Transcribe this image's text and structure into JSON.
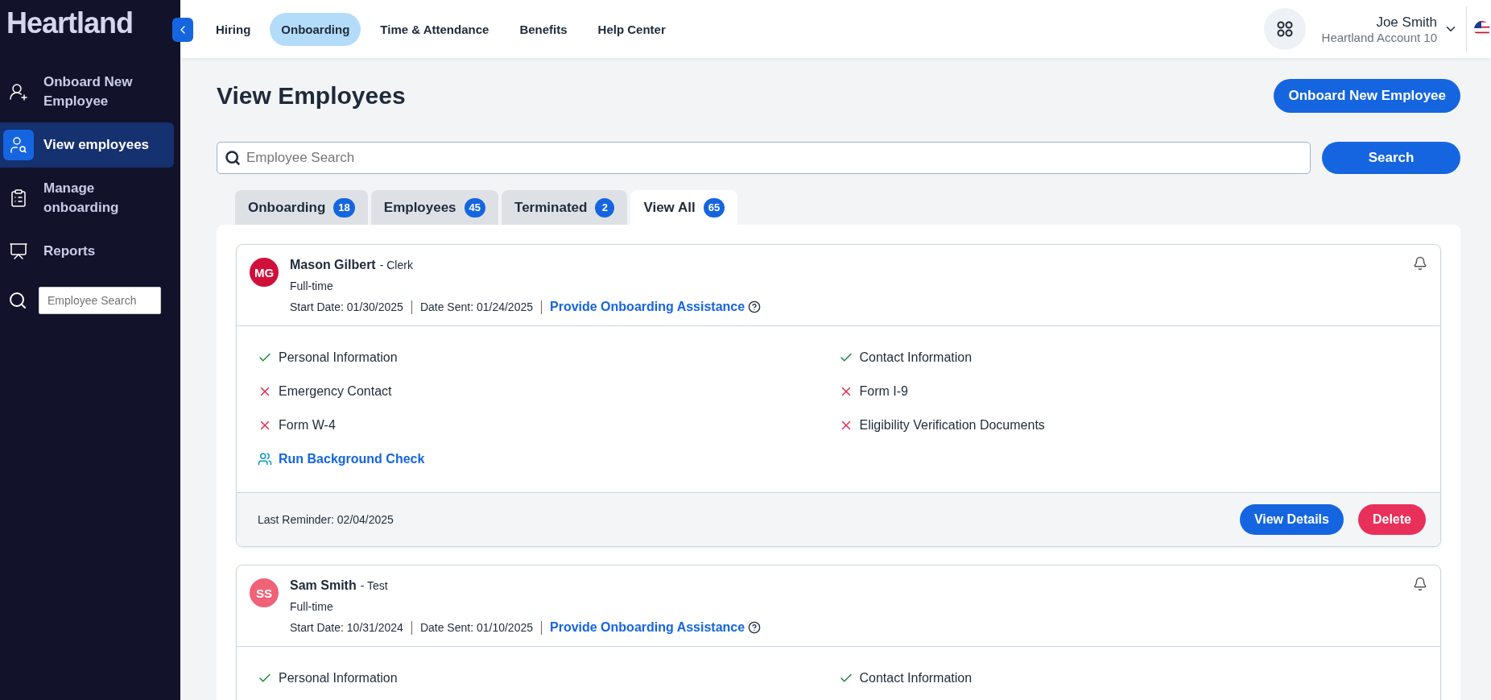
{
  "brand": {
    "name": "Heartland"
  },
  "sidebar": {
    "items": [
      {
        "label": "Onboard New Employee",
        "kind": "onboard",
        "selected": false
      },
      {
        "label": "View employees",
        "kind": "view",
        "selected": true
      },
      {
        "label": "Manage onboarding",
        "kind": "manage",
        "selected": false
      },
      {
        "label": "Reports",
        "kind": "reports",
        "selected": false
      }
    ],
    "search": {
      "placeholder": "Employee Search"
    }
  },
  "top_nav": [
    {
      "label": "Hiring",
      "selected": false
    },
    {
      "label": "Onboarding",
      "selected": true
    },
    {
      "label": "Time & Attendance",
      "selected": false
    },
    {
      "label": "Benefits",
      "selected": false
    },
    {
      "label": "Help Center",
      "selected": false
    }
  ],
  "user": {
    "name": "Joe Smith",
    "account": "Heartland Account 10"
  },
  "page": {
    "title": "View Employees",
    "primary_button": "Onboard New Employee"
  },
  "search": {
    "placeholder": "Employee Search",
    "button": "Search"
  },
  "tabs": [
    {
      "label": "Onboarding",
      "count": "18",
      "selected": false
    },
    {
      "label": "Employees",
      "count": "45",
      "selected": false
    },
    {
      "label": "Terminated",
      "count": "2",
      "selected": false
    },
    {
      "label": "View All",
      "count": "65",
      "selected": true
    }
  ],
  "employees": [
    {
      "initials": "MG",
      "color": "#d0103a",
      "name": "Mason Gilbert",
      "role": "- Clerk",
      "type": "Full-time",
      "start_date": "Start Date: 01/30/2025",
      "date_sent": "Date Sent: 01/24/2025",
      "assist_link": "Provide Onboarding Assistance",
      "tasks": [
        {
          "label": "Personal Information",
          "done": true
        },
        {
          "label": "Contact Information",
          "done": true
        },
        {
          "label": "Emergency Contact",
          "done": false
        },
        {
          "label": "Form I-9",
          "done": false
        },
        {
          "label": "Form W-4",
          "done": false
        },
        {
          "label": "Eligibility Verification Documents",
          "done": false
        }
      ],
      "background_check": "Run Background Check",
      "last_reminder": "Last Reminder: 02/04/2025",
      "buttons": [
        {
          "label": "View Details",
          "kind": "primary"
        },
        {
          "label": "Delete",
          "kind": "danger"
        }
      ]
    },
    {
      "initials": "SS",
      "color": "#f06277",
      "name": "Sam Smith",
      "role": "- Test",
      "type": "Full-time",
      "start_date": "Start Date: 10/31/2024",
      "date_sent": "Date Sent: 01/10/2025",
      "assist_link": "Provide Onboarding Assistance",
      "tasks": [
        {
          "label": "Personal Information",
          "done": true
        },
        {
          "label": "Contact Information",
          "done": true
        }
      ]
    }
  ]
}
